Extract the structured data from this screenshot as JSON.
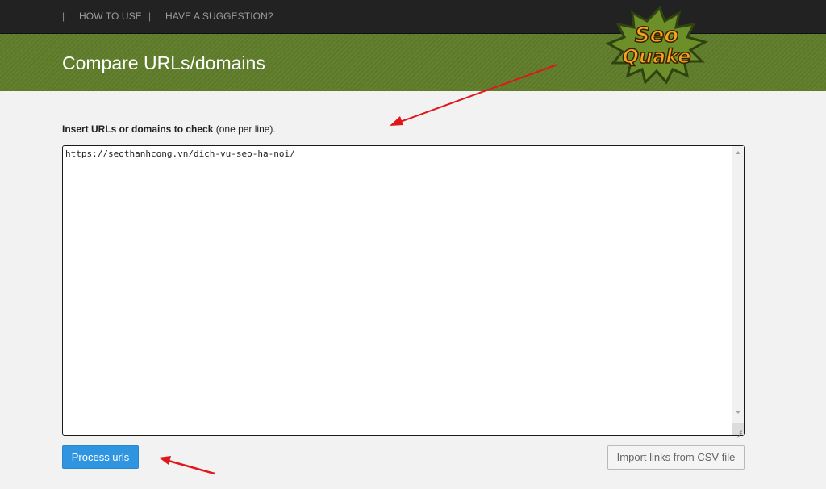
{
  "nav": {
    "separator": "|",
    "items": [
      {
        "label": "HOW TO USE"
      },
      {
        "label": "HAVE A SUGGESTION?"
      }
    ]
  },
  "header": {
    "title": "Compare URLs/domains",
    "logo": {
      "line1": "Seo",
      "line2": "Quake"
    }
  },
  "form": {
    "instruction_bold": "Insert URLs or domains to check",
    "instruction_rest": " (one per line).",
    "textarea_value": "https://seothanhcong.vn/dich-vu-seo-ha-noi/",
    "process_button": "Process urls",
    "import_button": "Import links from CSV file"
  },
  "colors": {
    "topbar": "#222222",
    "banner": "#5f7d2b",
    "accent_blue": "#2f95e0",
    "annotation_red": "#e0161b"
  }
}
